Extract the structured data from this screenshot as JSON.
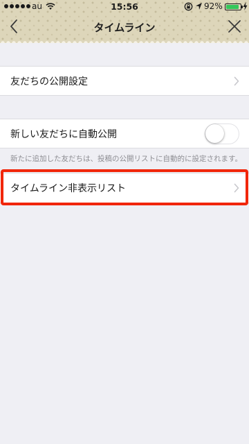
{
  "status_bar": {
    "carrier": "au",
    "time": "15:56",
    "battery": "92%",
    "battery_level": 0.92
  },
  "nav": {
    "title": "タイムライン",
    "back_icon": "chevron-left-icon",
    "close_icon": "close-icon"
  },
  "settings": {
    "privacy_label": "友だちの公開設定",
    "auto_publish_label": "新しい友だちに自動公開",
    "auto_publish_enabled": false,
    "auto_publish_note": "新たに追加した友だちは、投稿の公開リストに自動的に設定されます。",
    "hidden_list_label": "タイムライン非表示リスト"
  },
  "colors": {
    "header_bg": "#ddd6ba",
    "page_bg": "#efeff4",
    "highlight": "#f1260a",
    "battery": "#35c65a"
  }
}
